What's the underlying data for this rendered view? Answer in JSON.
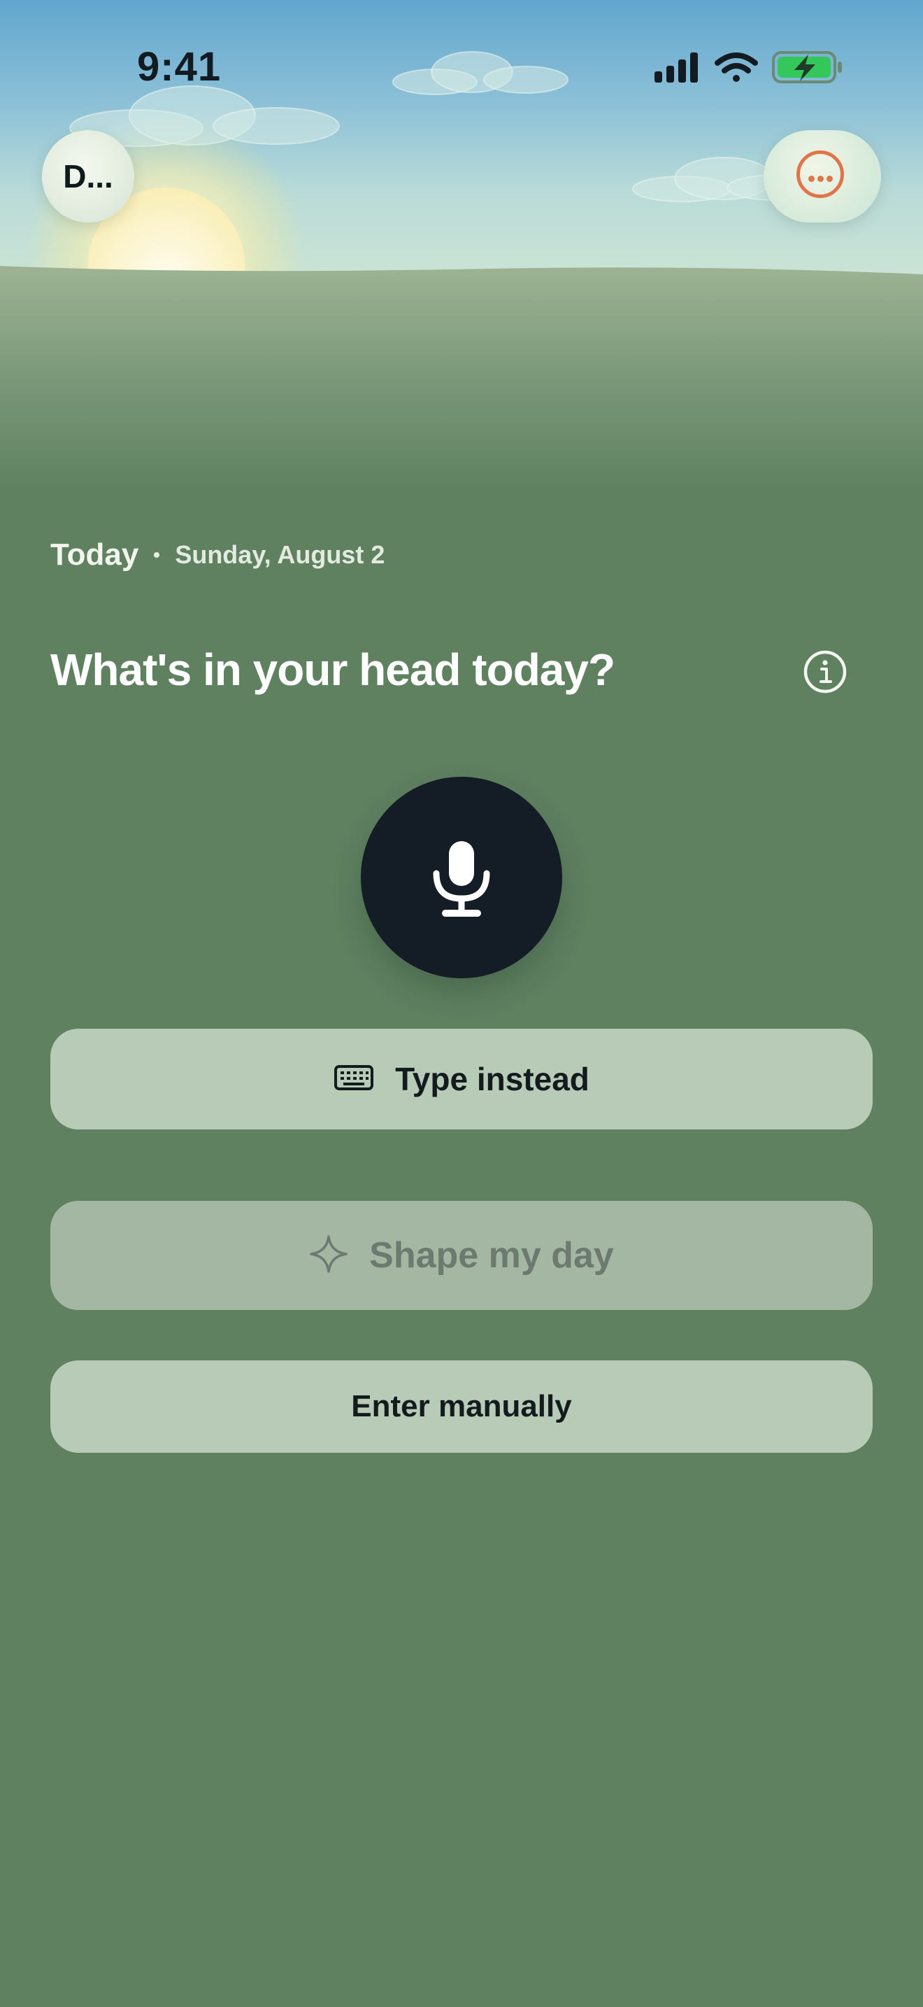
{
  "status_bar": {
    "time": "9:41",
    "icons": [
      "cellular-signal-icon",
      "wifi-icon",
      "battery-charging-icon"
    ]
  },
  "header": {
    "profile_label": "D...",
    "more_icon": "ellipsis-circle-icon"
  },
  "date": {
    "label": "Today",
    "full_date": "Sunday, August 2"
  },
  "prompt": {
    "title": "What's in your head today?",
    "info_icon": "info-circle-icon"
  },
  "actions": {
    "mic_icon": "microphone-icon",
    "type_instead": "Type instead",
    "shape_my_day": "Shape my day",
    "enter_manually": "Enter manually"
  },
  "colors": {
    "background": "#5f8160",
    "button_light": "#b8cbb7",
    "button_disabled": "#a4b7a3",
    "mic_button": "#141c25",
    "accent_orange": "#e17448",
    "battery_green": "#34c759"
  }
}
